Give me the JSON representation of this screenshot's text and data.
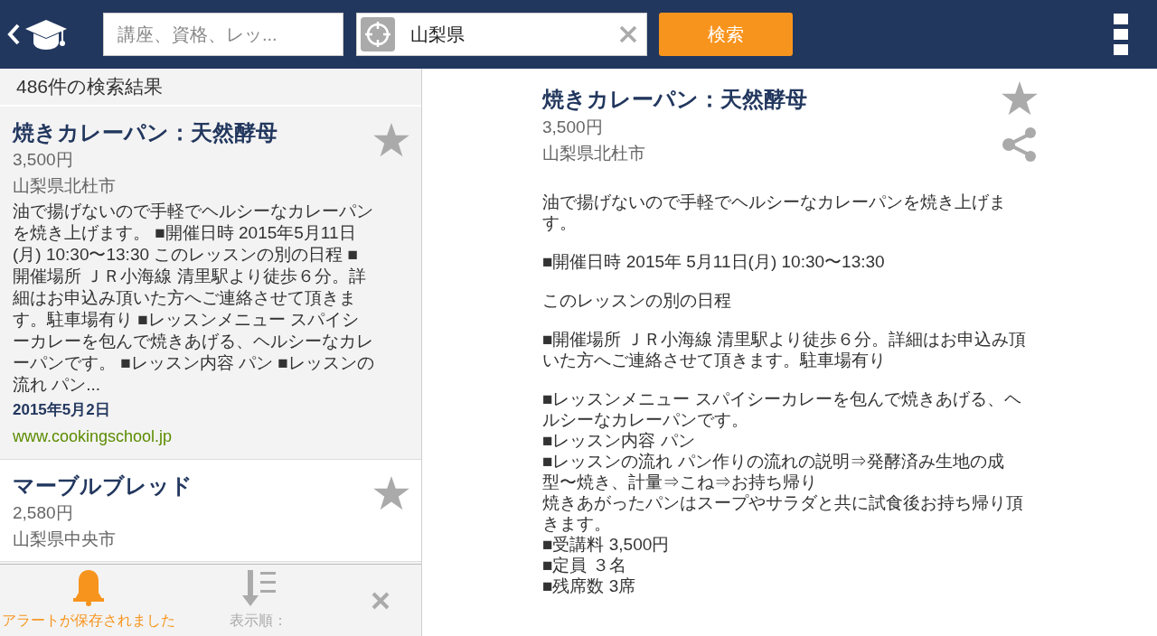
{
  "header": {
    "search": {
      "placeholder": "講座、資格、レッ..."
    },
    "location": {
      "value": "山梨県"
    },
    "search_button": "検索"
  },
  "results": {
    "count": "486件の検索結果",
    "items": [
      {
        "title": "焼きカレーパン：天然酵母",
        "price": "3,500円",
        "place": "山梨県北杜市",
        "description": "油で揚げないので手軽でヘルシーなカレーパンを焼き上げます。 ■開催日時 2015年5月11日(月) 10:30〜13:30 このレッスンの別の日程 ■開催場所 ＪＲ小海線 清里駅より徒歩６分。詳細はお申込み頂いた方へご連絡させて頂きます。駐車場有り ■レッスンメニュー スパイシーカレーを包んで焼きあげる、ヘルシーなカレーパンです。 ■レッスン内容 パン ■レッスンの流れ パン...",
        "date": "2015年5月2日",
        "url": "www.cookingschool.jp",
        "selected": true
      },
      {
        "title": "マーブルブレッド",
        "price": "2,580円",
        "place": "山梨県中央市",
        "selected": false
      }
    ]
  },
  "bottom_bar": {
    "alert": "アラートが保存されました",
    "sort": "表示順："
  },
  "detail": {
    "title": "焼きカレーパン：天然酵母",
    "price": "3,500円",
    "place": "山梨県北杜市",
    "paragraphs": [
      [
        "油で揚げないので手軽でヘルシーなカレーパンを焼き上げます。"
      ],
      [
        "■開催日時 2015年 5月11日(月) 10:30〜13:30"
      ],
      [
        "このレッスンの別の日程"
      ],
      [
        "■開催場所 ＪＲ小海線 清里駅より徒歩６分。詳細はお申込み頂いた方へご連絡させて頂きます。駐車場有り"
      ],
      [
        "■レッスンメニュー スパイシーカレーを包んで焼きあげる、ヘルシーなカレーパンです。",
        "■レッスン内容 パン",
        "■レッスンの流れ パン作りの流れの説明⇒発酵済み生地の成型〜焼き、計量⇒こね⇒お持ち帰り",
        "焼きあがったパンはスープやサラダと共に試食後お持ち帰り頂きます。",
        "■受講料 3,500円",
        "■定員 ３名",
        "■残席数 3席"
      ]
    ]
  }
}
